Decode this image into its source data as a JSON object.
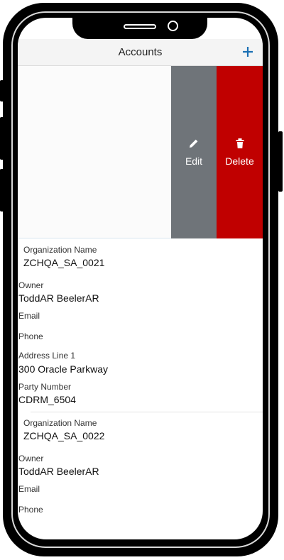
{
  "header": {
    "title": "Accounts"
  },
  "swipe_actions": {
    "edit_label": "Edit",
    "delete_label": "Delete"
  },
  "records": [
    {
      "org_label": "Organization Name",
      "org_value": "ZCHQA_SA_0021",
      "owner_label": "Owner",
      "owner_value": "ToddAR BeelerAR",
      "email_label": "Email",
      "phone_label": "Phone",
      "address_label": "Address Line 1",
      "address_value": "300 Oracle Parkway",
      "party_label": "Party Number",
      "party_value": "CDRM_6504"
    },
    {
      "org_label": "Organization Name",
      "org_value": "ZCHQA_SA_0022",
      "owner_label": "Owner",
      "owner_value": "ToddAR BeelerAR",
      "email_label": "Email",
      "phone_label": "Phone"
    }
  ],
  "colors": {
    "accent": "#1a6fb3",
    "edit": "#6f7479",
    "delete": "#c00000"
  }
}
